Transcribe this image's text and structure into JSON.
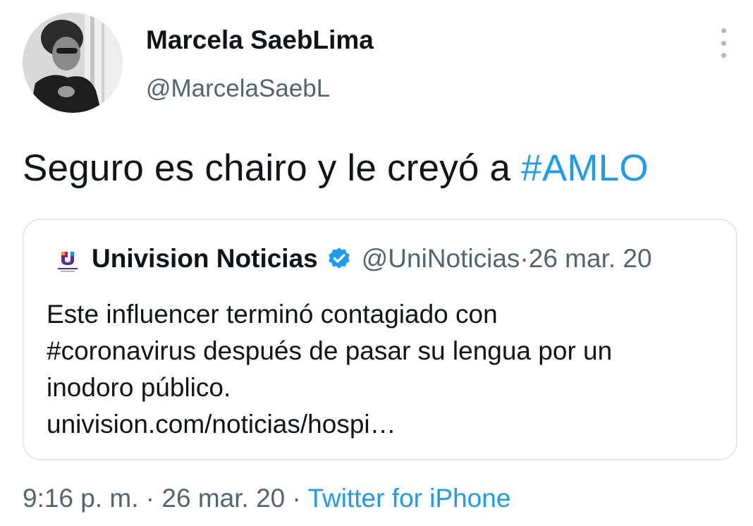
{
  "author": {
    "display_name": "Marcela SaebLima",
    "handle": "@MarcelaSaebL"
  },
  "tweet": {
    "text_before": "Seguro es chairo y le creyó a ",
    "hashtag": "#AMLO"
  },
  "quoted_tweet": {
    "display_name": "Univision Noticias",
    "verified": true,
    "handle": "@UniNoticias",
    "separator": " · ",
    "date": "26 mar. 20",
    "logo_text": "UNIVISION NOTICIAS",
    "body_lines": [
      "Este influencer terminó contagiado con",
      "#coronavirus después de pasar su lengua por un",
      "inodoro público.",
      "univision.com/noticias/hospi…"
    ]
  },
  "footer": {
    "time": "9:16 p. m.",
    "separator1": " · ",
    "date": "26 mar. 20",
    "separator2": " · ",
    "source": "Twitter for iPhone"
  },
  "icons": {
    "more": "more-vertical-icon",
    "verified": "verified-badge-icon",
    "logo": "univision-logo-icon"
  },
  "colors": {
    "link": "#1d9bf0",
    "secondary_text": "#536471",
    "border": "#e1e8ed"
  }
}
